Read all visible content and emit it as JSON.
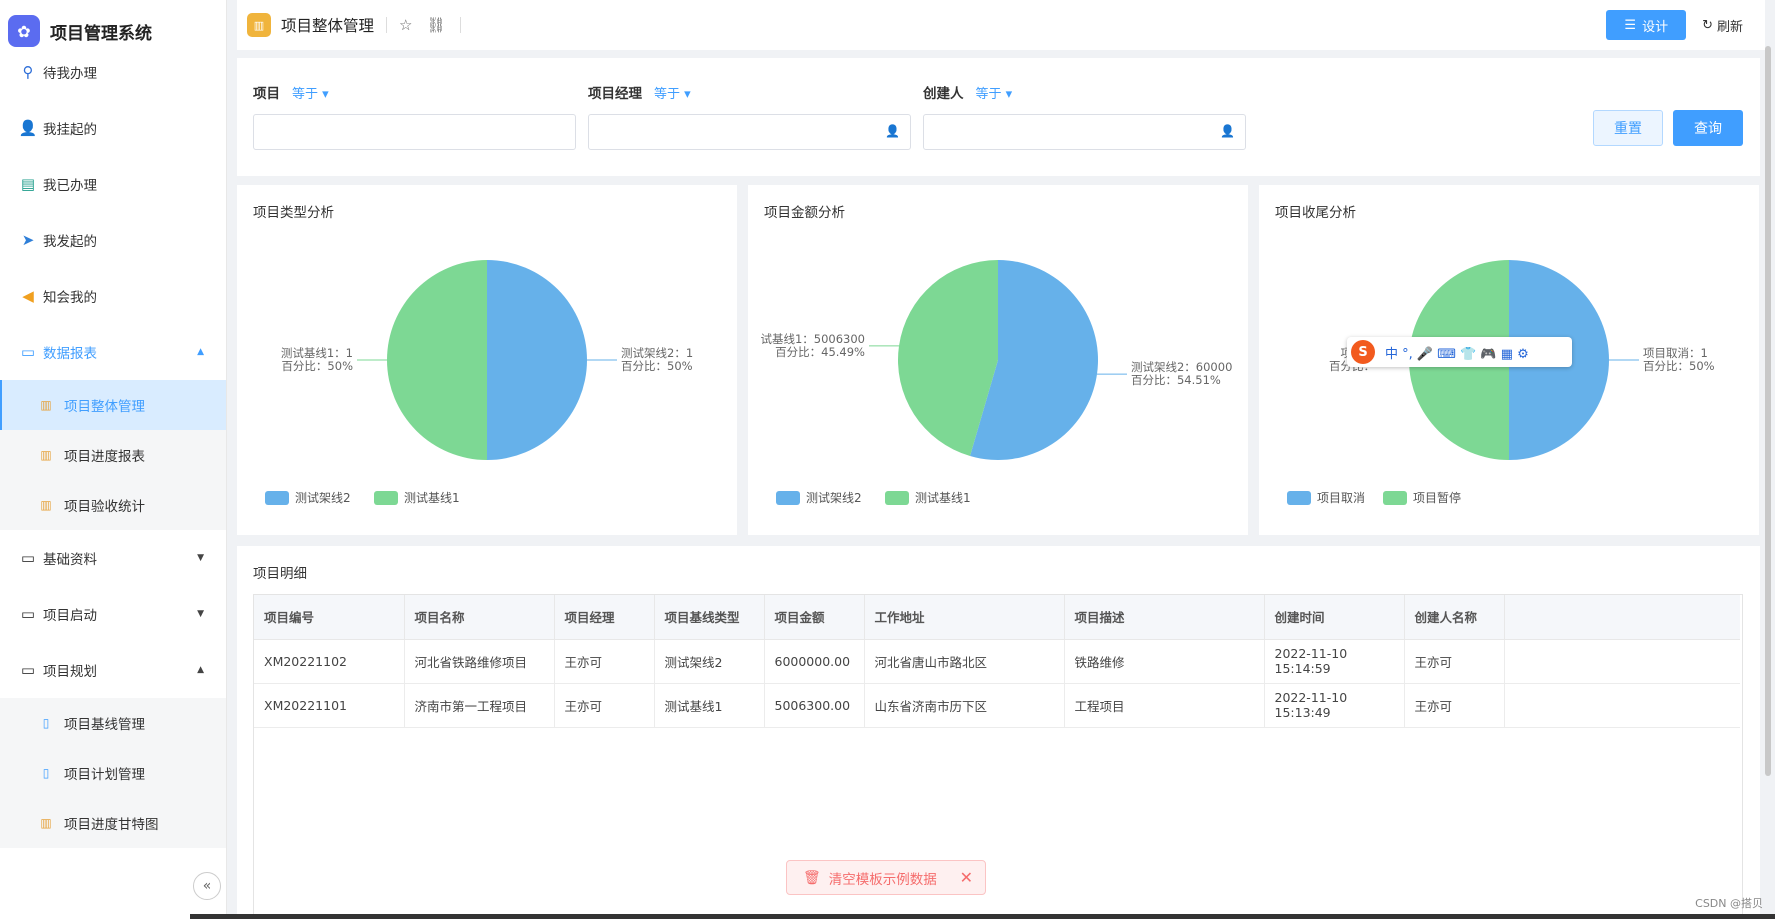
{
  "app": {
    "title": "项目管理系统"
  },
  "sidebar": {
    "top_items": [
      {
        "label": "待我办理",
        "icon": "stamp-icon"
      },
      {
        "label": "我挂起的",
        "icon": "user-pause-icon"
      },
      {
        "label": "我已办理",
        "icon": "done-list-icon"
      },
      {
        "label": "我发起的",
        "icon": "send-icon"
      },
      {
        "label": "知会我的",
        "icon": "megaphone-icon"
      }
    ],
    "groups": [
      {
        "label": "数据报表",
        "expanded": true,
        "children": [
          {
            "label": "项目整体管理",
            "active": true
          },
          {
            "label": "项目进度报表"
          },
          {
            "label": "项目验收统计"
          }
        ]
      },
      {
        "label": "基础资料",
        "expanded": false
      },
      {
        "label": "项目启动",
        "expanded": false
      },
      {
        "label": "项目规划",
        "expanded": true,
        "children": [
          {
            "label": "项目基线管理"
          },
          {
            "label": "项目计划管理"
          },
          {
            "label": "项目进度甘特图"
          }
        ]
      }
    ]
  },
  "header": {
    "title": "项目整体管理",
    "design_label": "设计",
    "refresh_label": "刷新"
  },
  "filters": [
    {
      "label": "项目",
      "op": "等于",
      "value": ""
    },
    {
      "label": "项目经理",
      "op": "等于",
      "value": ""
    },
    {
      "label": "创建人",
      "op": "等于",
      "value": ""
    }
  ],
  "buttons": {
    "reset": "重置",
    "query": "查询"
  },
  "charts": {
    "type": {
      "title": "项目类型分析"
    },
    "amount": {
      "title": "项目金额分析"
    },
    "closing": {
      "title": "项目收尾分析"
    }
  },
  "chart_data": [
    {
      "type": "pie",
      "title": "项目类型分析",
      "slices": [
        {
          "name": "测试架线2",
          "value": 1,
          "percent": "50%",
          "color": "#66b1ea"
        },
        {
          "name": "测试基线1",
          "value": 1,
          "percent": "50%",
          "color": "#7dd894"
        }
      ],
      "labels": [
        {
          "line1": "测试架线2：1",
          "line2": "百分比：50%"
        },
        {
          "line1": "测试基线1：1",
          "line2": "百分比：50%"
        }
      ],
      "legend": [
        "测试架线2",
        "测试基线1"
      ],
      "legend_position": "bottom-left"
    },
    {
      "type": "pie",
      "title": "项目金额分析",
      "slices": [
        {
          "name": "测试架线2",
          "value": 6000000,
          "percent": "54.51%",
          "color": "#66b1ea"
        },
        {
          "name": "测试基线1",
          "value": 5006300,
          "percent": "45.49%",
          "color": "#7dd894"
        }
      ],
      "labels": [
        {
          "line1": "测试架线2：60000",
          "line2": "百分比：54.51%"
        },
        {
          "line1": "试基线1：5006300",
          "line2": "百分比：45.49%"
        }
      ],
      "legend": [
        "测试架线2",
        "测试基线1"
      ],
      "legend_position": "bottom-left"
    },
    {
      "type": "pie",
      "title": "项目收尾分析",
      "slices": [
        {
          "name": "项目取消",
          "value": 1,
          "percent": "50%",
          "color": "#66b1ea"
        },
        {
          "name": "项目暂停",
          "value": 1,
          "percent": "50%",
          "color": "#7dd894"
        }
      ],
      "labels": [
        {
          "line1": "项目取消：1",
          "line2": "百分比：50%"
        },
        {
          "line1": "项目暂",
          "line2": "百分比："
        }
      ],
      "legend": [
        "项目取消",
        "项目暂停"
      ],
      "legend_position": "bottom-left"
    }
  ],
  "table": {
    "title": "项目明细",
    "columns": [
      "项目编号",
      "项目名称",
      "项目经理",
      "项目基线类型",
      "项目金额",
      "工作地址",
      "项目描述",
      "创建时间",
      "创建人名称"
    ],
    "rows": [
      [
        "XM20221102",
        "河北省铁路维修项目",
        "王亦可",
        "测试架线2",
        "6000000.00",
        "河北省唐山市路北区",
        "铁路维修",
        "2022-11-10 15:14:59",
        "王亦可"
      ],
      [
        "XM20221101",
        "济南市第一工程项目",
        "王亦可",
        "测试基线1",
        "5006300.00",
        "山东省济南市历下区",
        "工程项目",
        "2022-11-10 15:13:49",
        "王亦可"
      ]
    ]
  },
  "toast": {
    "message": "清空模板示例数据"
  },
  "ime": {
    "text": "中 °, 🎤 ⌨ 👕 🎮 ▦ ⚙"
  },
  "watermark": "CSDN @搭贝",
  "colors": {
    "primary": "#409eff",
    "slice_blue": "#66b1ea",
    "slice_green": "#7dd894",
    "danger": "#f56c6c"
  }
}
